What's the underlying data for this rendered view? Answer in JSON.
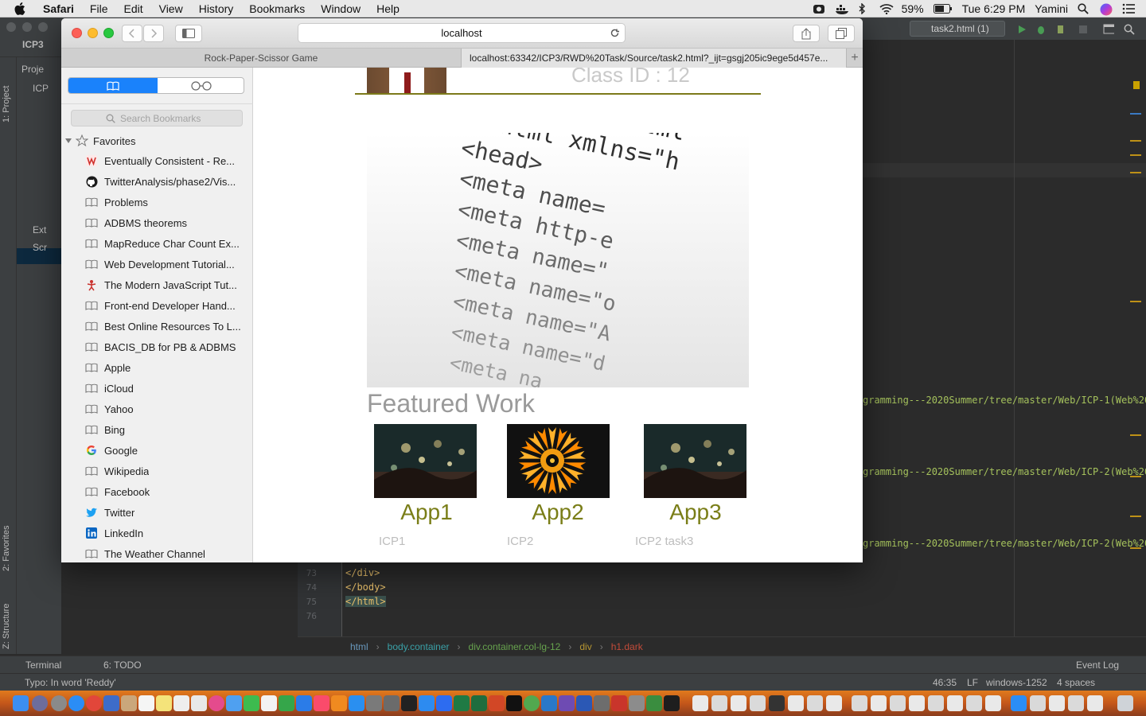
{
  "menubar": {
    "app_name": "Safari",
    "items": [
      "File",
      "Edit",
      "View",
      "History",
      "Bookmarks",
      "Window",
      "Help"
    ],
    "battery": "59%",
    "clock": "Tue 6:29 PM",
    "user": "Yamini"
  },
  "ide": {
    "project_crumb": "ICP3",
    "run_config": "task2.html (1)",
    "project_tab": "1: Project",
    "favorites_tab": "2: Favorites",
    "structure_tab": "Z: Structure",
    "tree_rows": [
      "Proje",
      "ICP",
      "",
      "",
      "",
      "Ext",
      "Scr"
    ],
    "code_urls": [
      "gramming---2020Summer/tree/master/Web/ICP-1(Web%20",
      "gramming---2020Summer/tree/master/Web/ICP-2(Web%20",
      "gramming---2020Summer/tree/master/Web/ICP-2(Web%20"
    ],
    "code_lines": [
      {
        "num": "73",
        "text": "</div>"
      },
      {
        "num": "74",
        "text": "</body>"
      },
      {
        "num": "75",
        "text": "</html>"
      },
      {
        "num": "76",
        "text": ""
      }
    ],
    "breadcrumbs": [
      "html",
      "body.container",
      "div.container.col-lg-12",
      "div",
      "h1.dark"
    ],
    "bottom_tools": {
      "terminal": "Terminal",
      "todo": "6: TODO",
      "event_log": "Event Log"
    },
    "status": {
      "message": "Typo: In word 'Reddy'",
      "position": "46:35",
      "line_sep": "LF",
      "encoding": "windows-1252",
      "indent": "4 spaces"
    }
  },
  "safari": {
    "address": "localhost",
    "tabs": [
      {
        "title": "Rock-Paper-Scissor Game",
        "active": false
      },
      {
        "title": "localhost:63342/ICP3/RWD%20Task/Source/task2.html?_ijt=gsgj205ic9ege5d457e...",
        "active": true
      }
    ],
    "sidebar": {
      "search_placeholder": "Search Bookmarks",
      "favorites_label": "Favorites",
      "bookmarks": [
        {
          "label": "Eventually Consistent - Re...",
          "icon": "w-red-icon"
        },
        {
          "label": "TwitterAnalysis/phase2/Vis...",
          "icon": "github-icon"
        },
        {
          "label": "Problems",
          "icon": "book-icon"
        },
        {
          "label": "ADBMS theorems",
          "icon": "book-icon"
        },
        {
          "label": "MapReduce Char Count Ex...",
          "icon": "book-icon"
        },
        {
          "label": "Web Development Tutorial...",
          "icon": "book-icon"
        },
        {
          "label": "The Modern JavaScript Tut...",
          "icon": "js-figure-icon"
        },
        {
          "label": "Front-end Developer Hand...",
          "icon": "book-icon"
        },
        {
          "label": "Best Online Resources To L...",
          "icon": "book-icon"
        },
        {
          "label": "BACIS_DB for PB & ADBMS",
          "icon": "book-icon"
        },
        {
          "label": "Apple",
          "icon": "book-icon"
        },
        {
          "label": "iCloud",
          "icon": "book-icon"
        },
        {
          "label": "Yahoo",
          "icon": "book-icon"
        },
        {
          "label": "Bing",
          "icon": "book-icon"
        },
        {
          "label": "Google",
          "icon": "google-icon"
        },
        {
          "label": "Wikipedia",
          "icon": "book-icon"
        },
        {
          "label": "Facebook",
          "icon": "book-icon"
        },
        {
          "label": "Twitter",
          "icon": "twitter-icon"
        },
        {
          "label": "LinkedIn",
          "icon": "linkedin-icon"
        },
        {
          "label": "The Weather Channel",
          "icon": "book-icon"
        }
      ]
    },
    "page": {
      "class_id": "Class ID : 12",
      "hero_code": [
        "<!DOCTYPE html",
        "<html xmlns=\"h",
        "<head>",
        "<meta name=",
        "<meta http-e",
        "<meta name=\"",
        "<meta name=\"o",
        "<meta name=\"A",
        "<meta name=\"d",
        "<meta na"
      ],
      "featured_title": "Featured Work",
      "apps": [
        {
          "name": "App1",
          "subtitle": "ICP1"
        },
        {
          "name": "App2",
          "subtitle": "ICP2"
        },
        {
          "name": "App3",
          "subtitle": "ICP2 task3"
        }
      ]
    }
  },
  "colors": {
    "accent_olive": "#7a7e18",
    "segment_blue": "#1a82fb",
    "ide_bg": "#2b2b2b"
  }
}
